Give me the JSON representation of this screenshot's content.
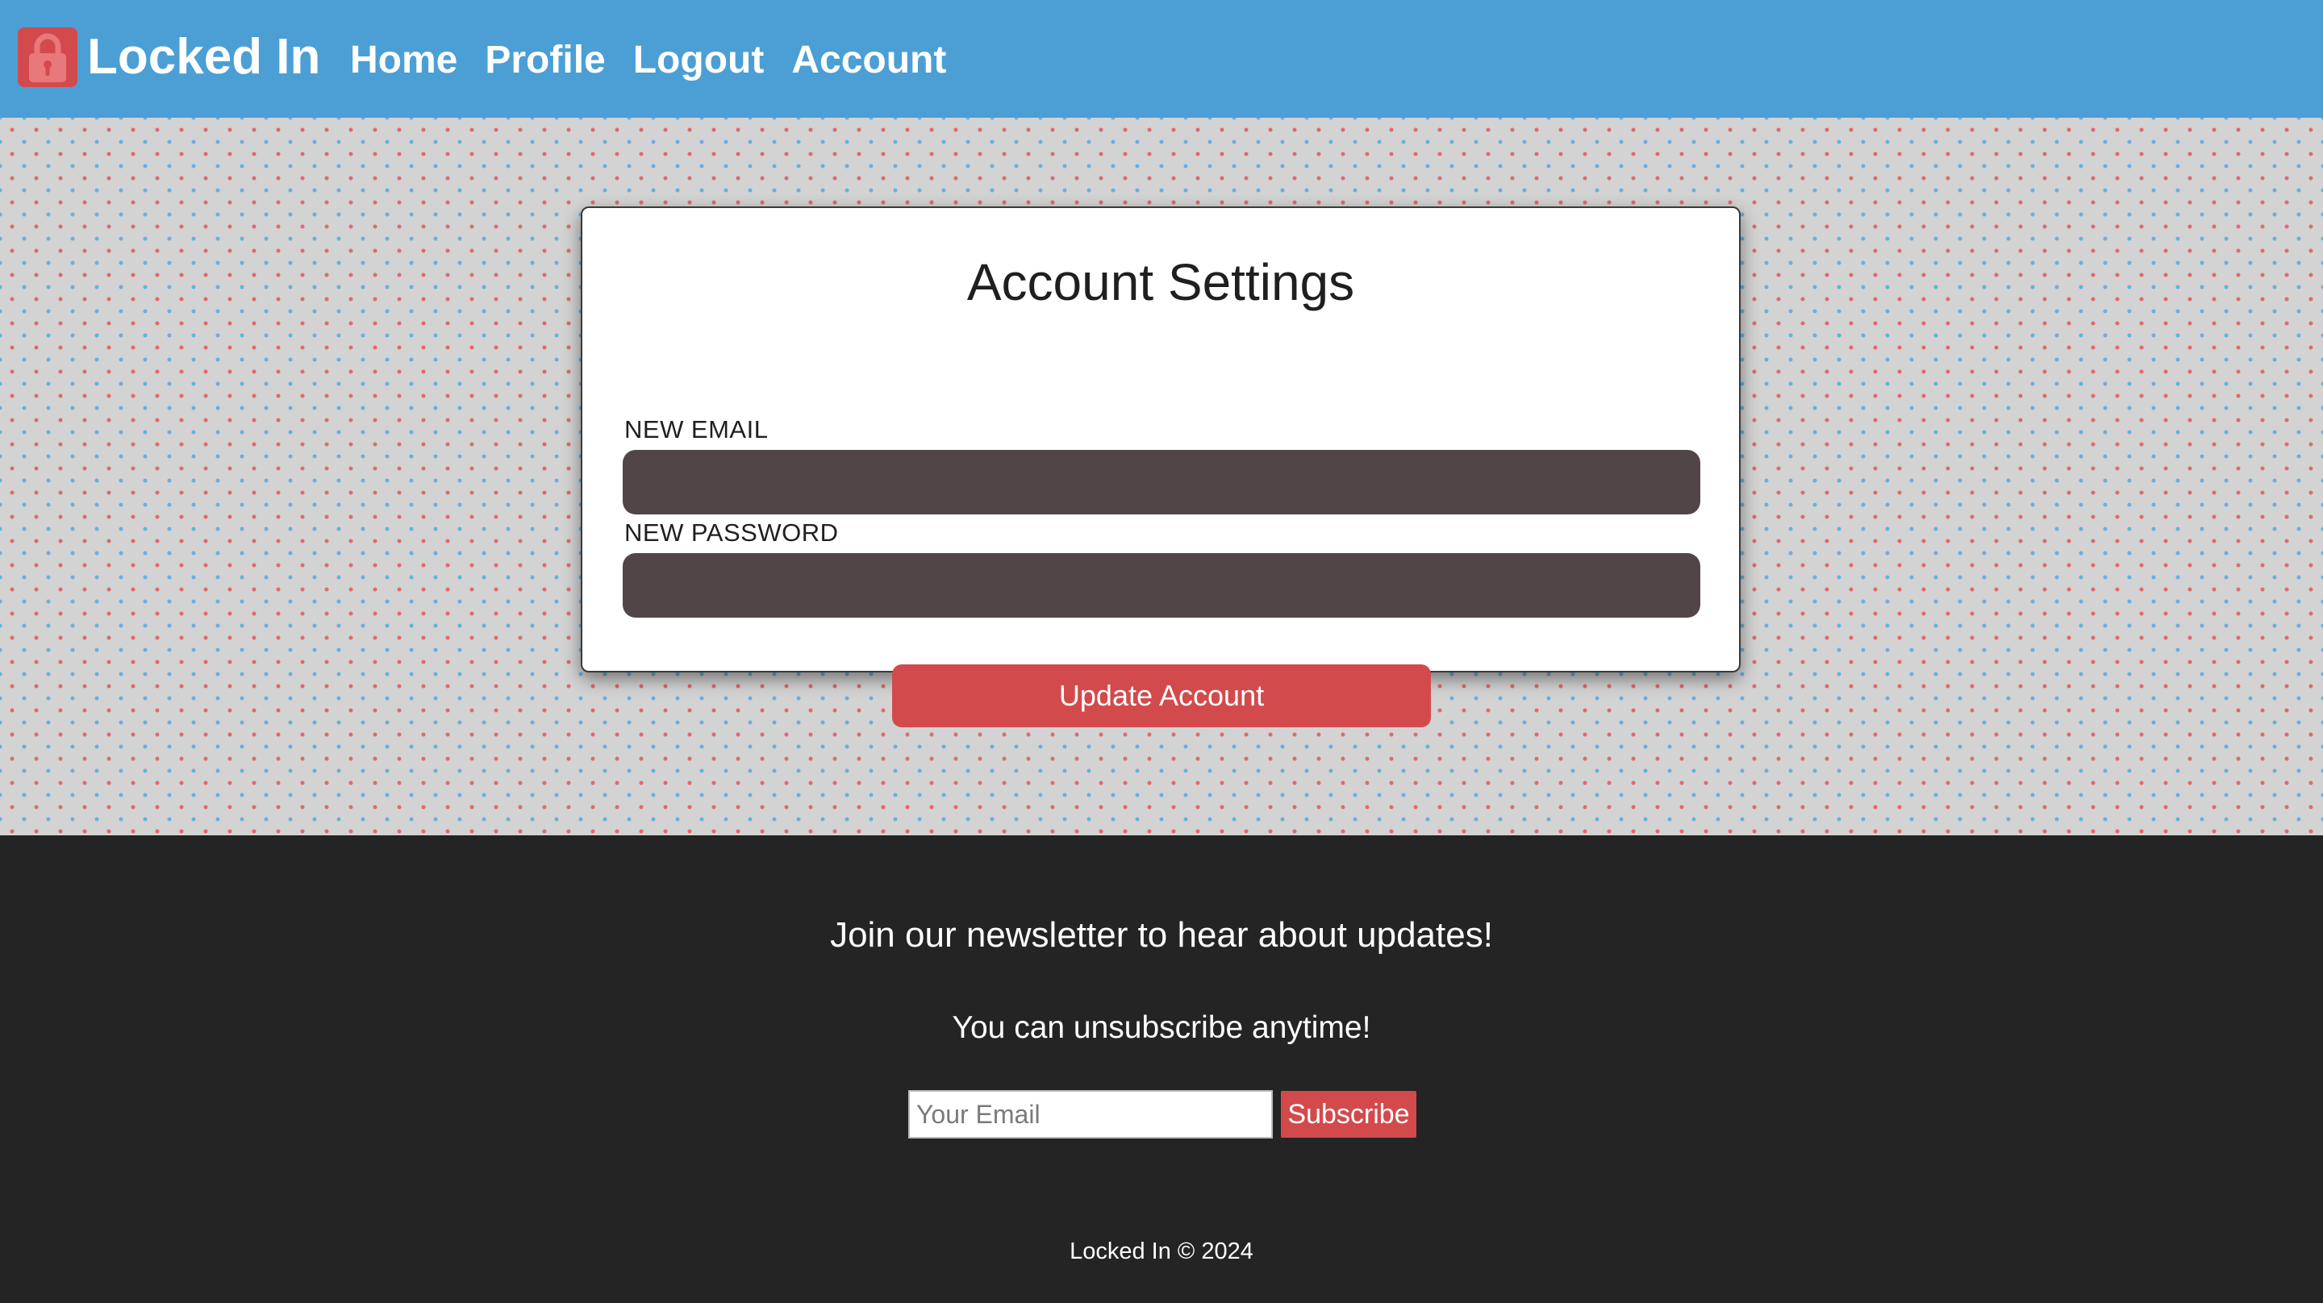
{
  "header": {
    "brand_name": "Locked In",
    "logo_icon": "padlock-icon",
    "nav": {
      "home": "Home",
      "profile": "Profile",
      "logout": "Logout",
      "account": "Account"
    }
  },
  "account_form": {
    "title": "Account Settings",
    "email_label": "NEW EMAIL",
    "email_value": "",
    "password_label": "NEW PASSWORD",
    "password_value": "",
    "submit_label": "Update Account"
  },
  "footer": {
    "newsletter_title": "Join our newsletter to hear about updates!",
    "newsletter_subtitle": "You can unsubscribe anytime!",
    "email_placeholder": "Your Email",
    "subscribe_label": "Subscribe",
    "copyright": "Locked In © 2024"
  },
  "colors": {
    "header_bg": "#4b9fd5",
    "accent_red": "#d34a4c",
    "input_dark": "#514547",
    "page_bg": "#d3d3d3",
    "footer_bg": "#242424"
  }
}
